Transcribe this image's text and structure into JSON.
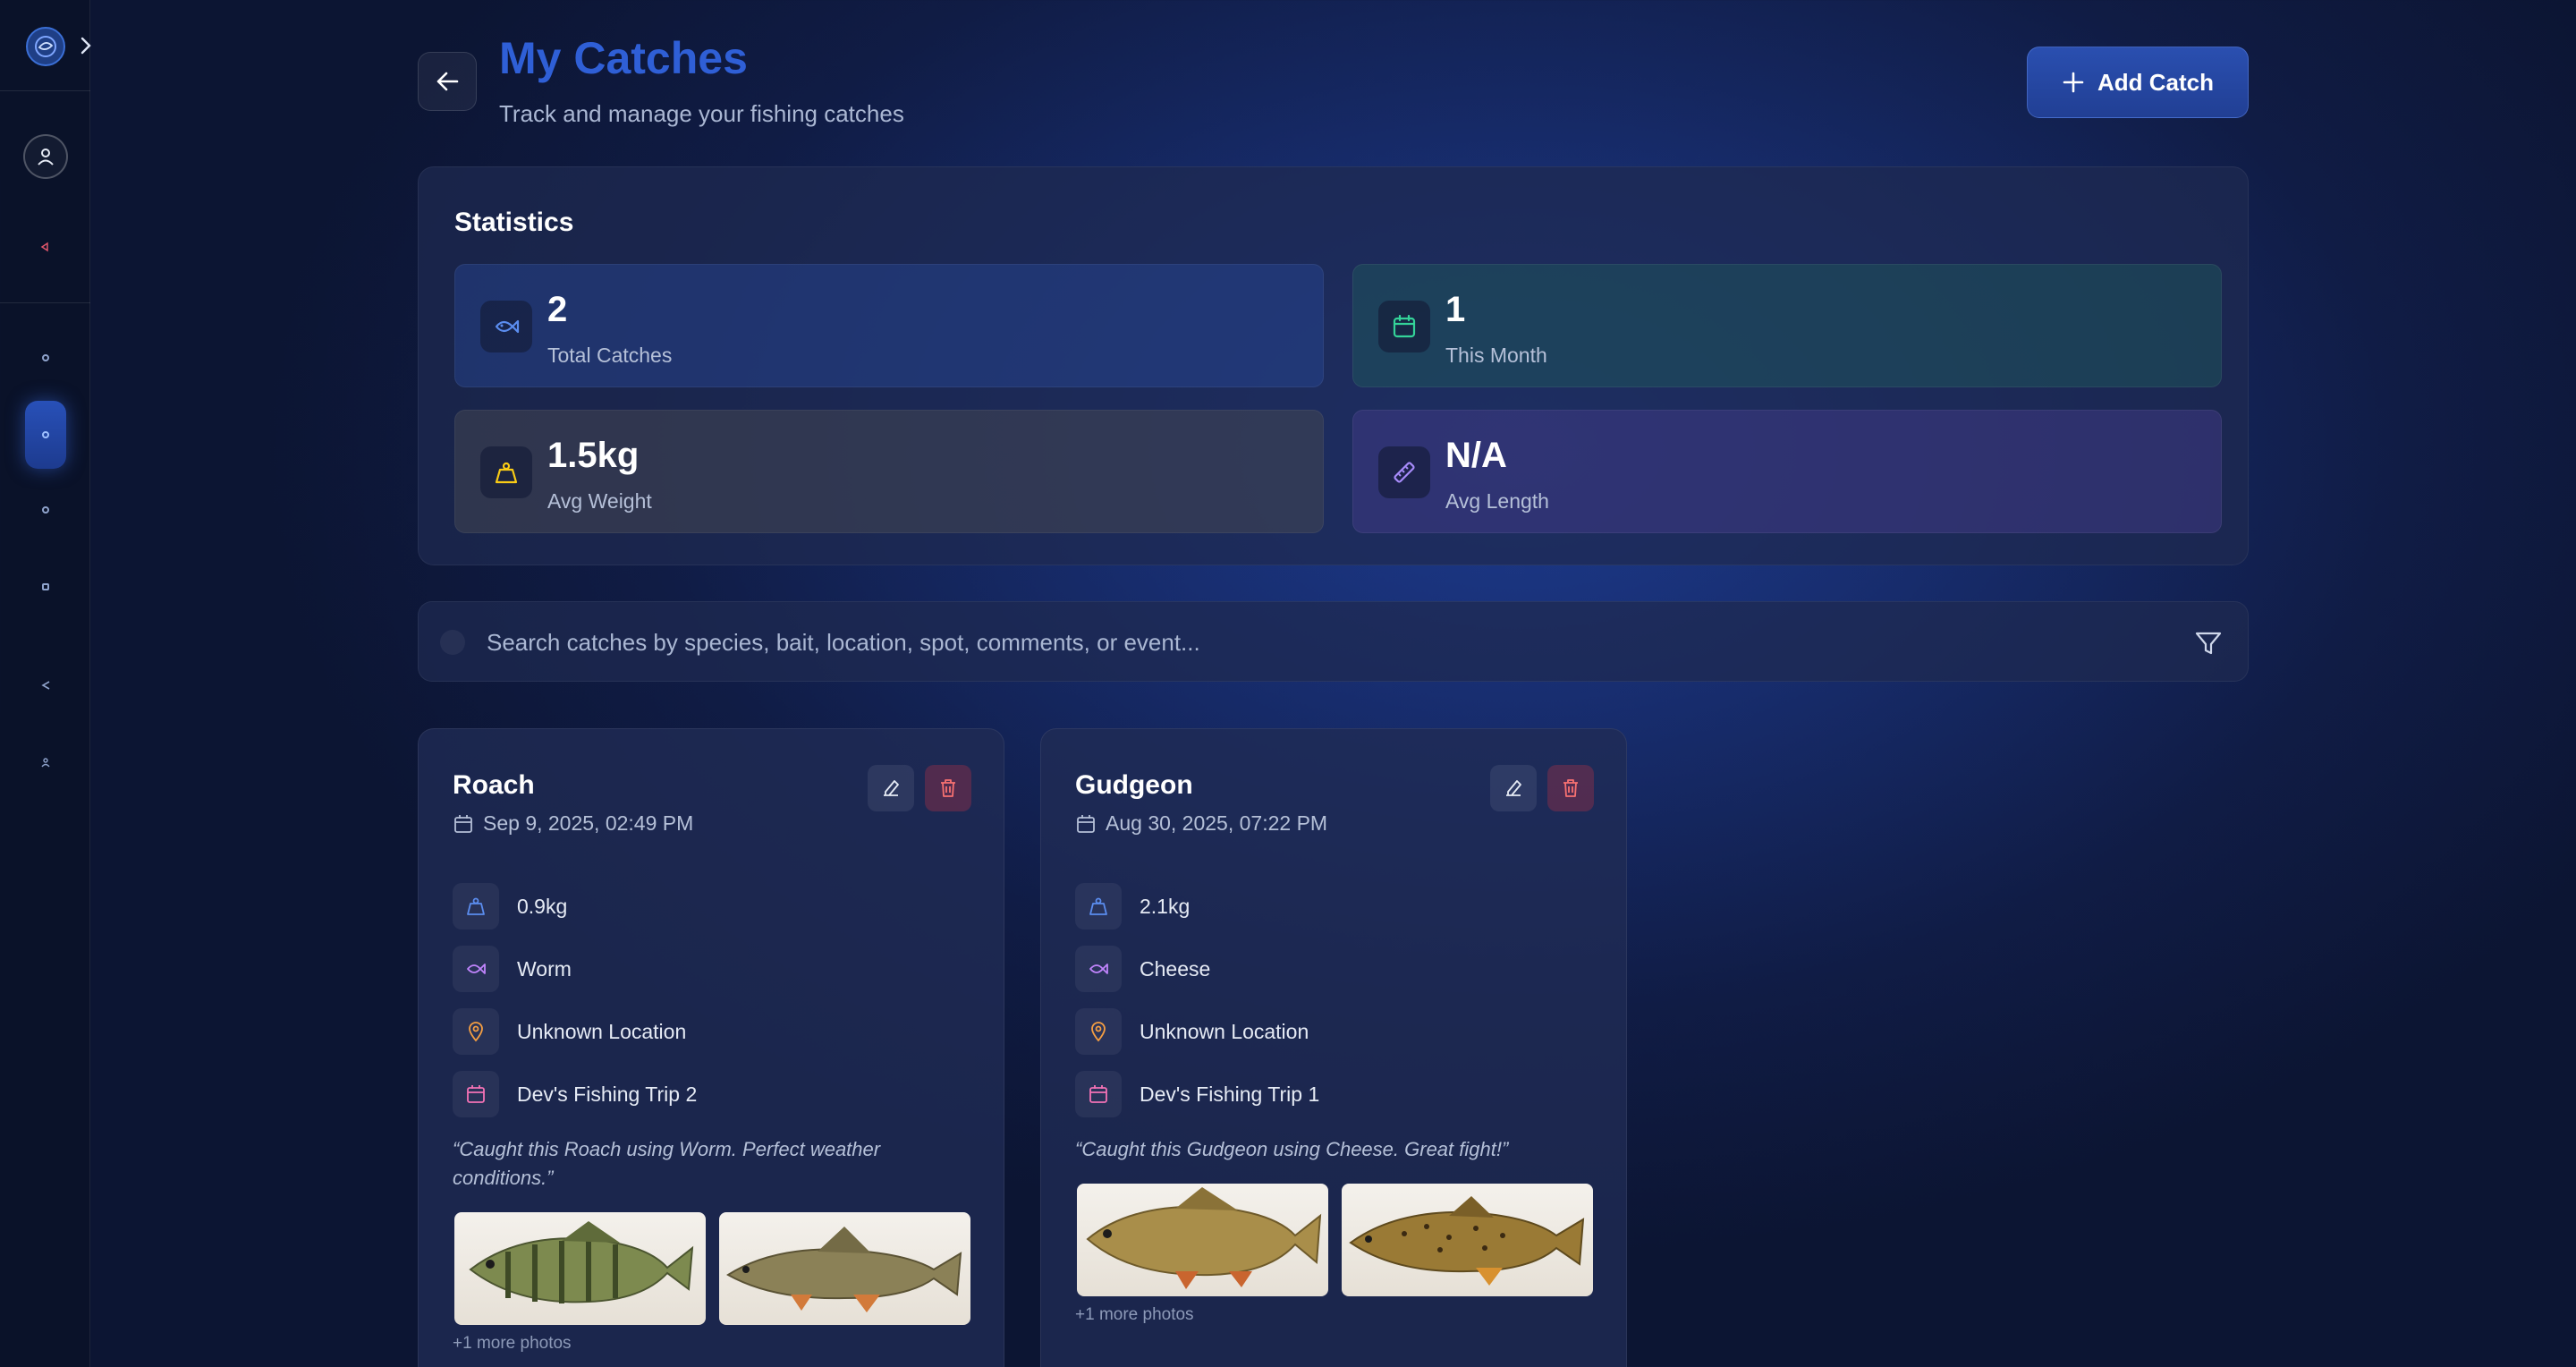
{
  "sidebar": {
    "icons": [
      "logo-icon",
      "expand-icon",
      "user-icon",
      "fish-icon",
      "home-icon",
      "catches-icon",
      "map-icon",
      "calendar-icon",
      "share-icon",
      "group-icon"
    ]
  },
  "header": {
    "title": "My Catches",
    "subtitle": "Track and manage your fishing catches",
    "add_label": "Add Catch"
  },
  "stats": {
    "title": "Statistics",
    "cards": [
      {
        "value": "2",
        "label": "Total Catches",
        "icon": "fish-icon",
        "color": "#5b8def"
      },
      {
        "value": "1",
        "label": "This Month",
        "icon": "calendar-icon",
        "color": "#34d399"
      },
      {
        "value": "1.5kg",
        "label": "Avg Weight",
        "icon": "weight-icon",
        "color": "#facc15"
      },
      {
        "value": "N/A",
        "label": "Avg Length",
        "icon": "ruler-icon",
        "color": "#a78bfa"
      }
    ]
  },
  "search": {
    "placeholder": "Search catches by species, bait, location, spot, comments, or event..."
  },
  "catches": [
    {
      "species": "Roach",
      "date": "Sep 9, 2025, 02:49 PM",
      "weight": "0.9kg",
      "bait": "Worm",
      "location": "Unknown Location",
      "event": "Dev's Fishing Trip 2",
      "comment": "“Caught this Roach using Worm. Perfect weather conditions.”",
      "more_photos": "+1 more photos"
    },
    {
      "species": "Gudgeon",
      "date": "Aug 30, 2025, 07:22 PM",
      "weight": "2.1kg",
      "bait": "Cheese",
      "location": "Unknown Location",
      "event": "Dev's Fishing Trip 1",
      "comment": "“Caught this Gudgeon using Cheese. Great fight!”",
      "more_photos": "+1 more photos"
    }
  ],
  "colors": {
    "accent": "#2f5fd6",
    "weight": "#5b8def",
    "bait": "#c084fc",
    "location": "#f59e42",
    "event": "#f472b6",
    "delete": "#f87171"
  }
}
